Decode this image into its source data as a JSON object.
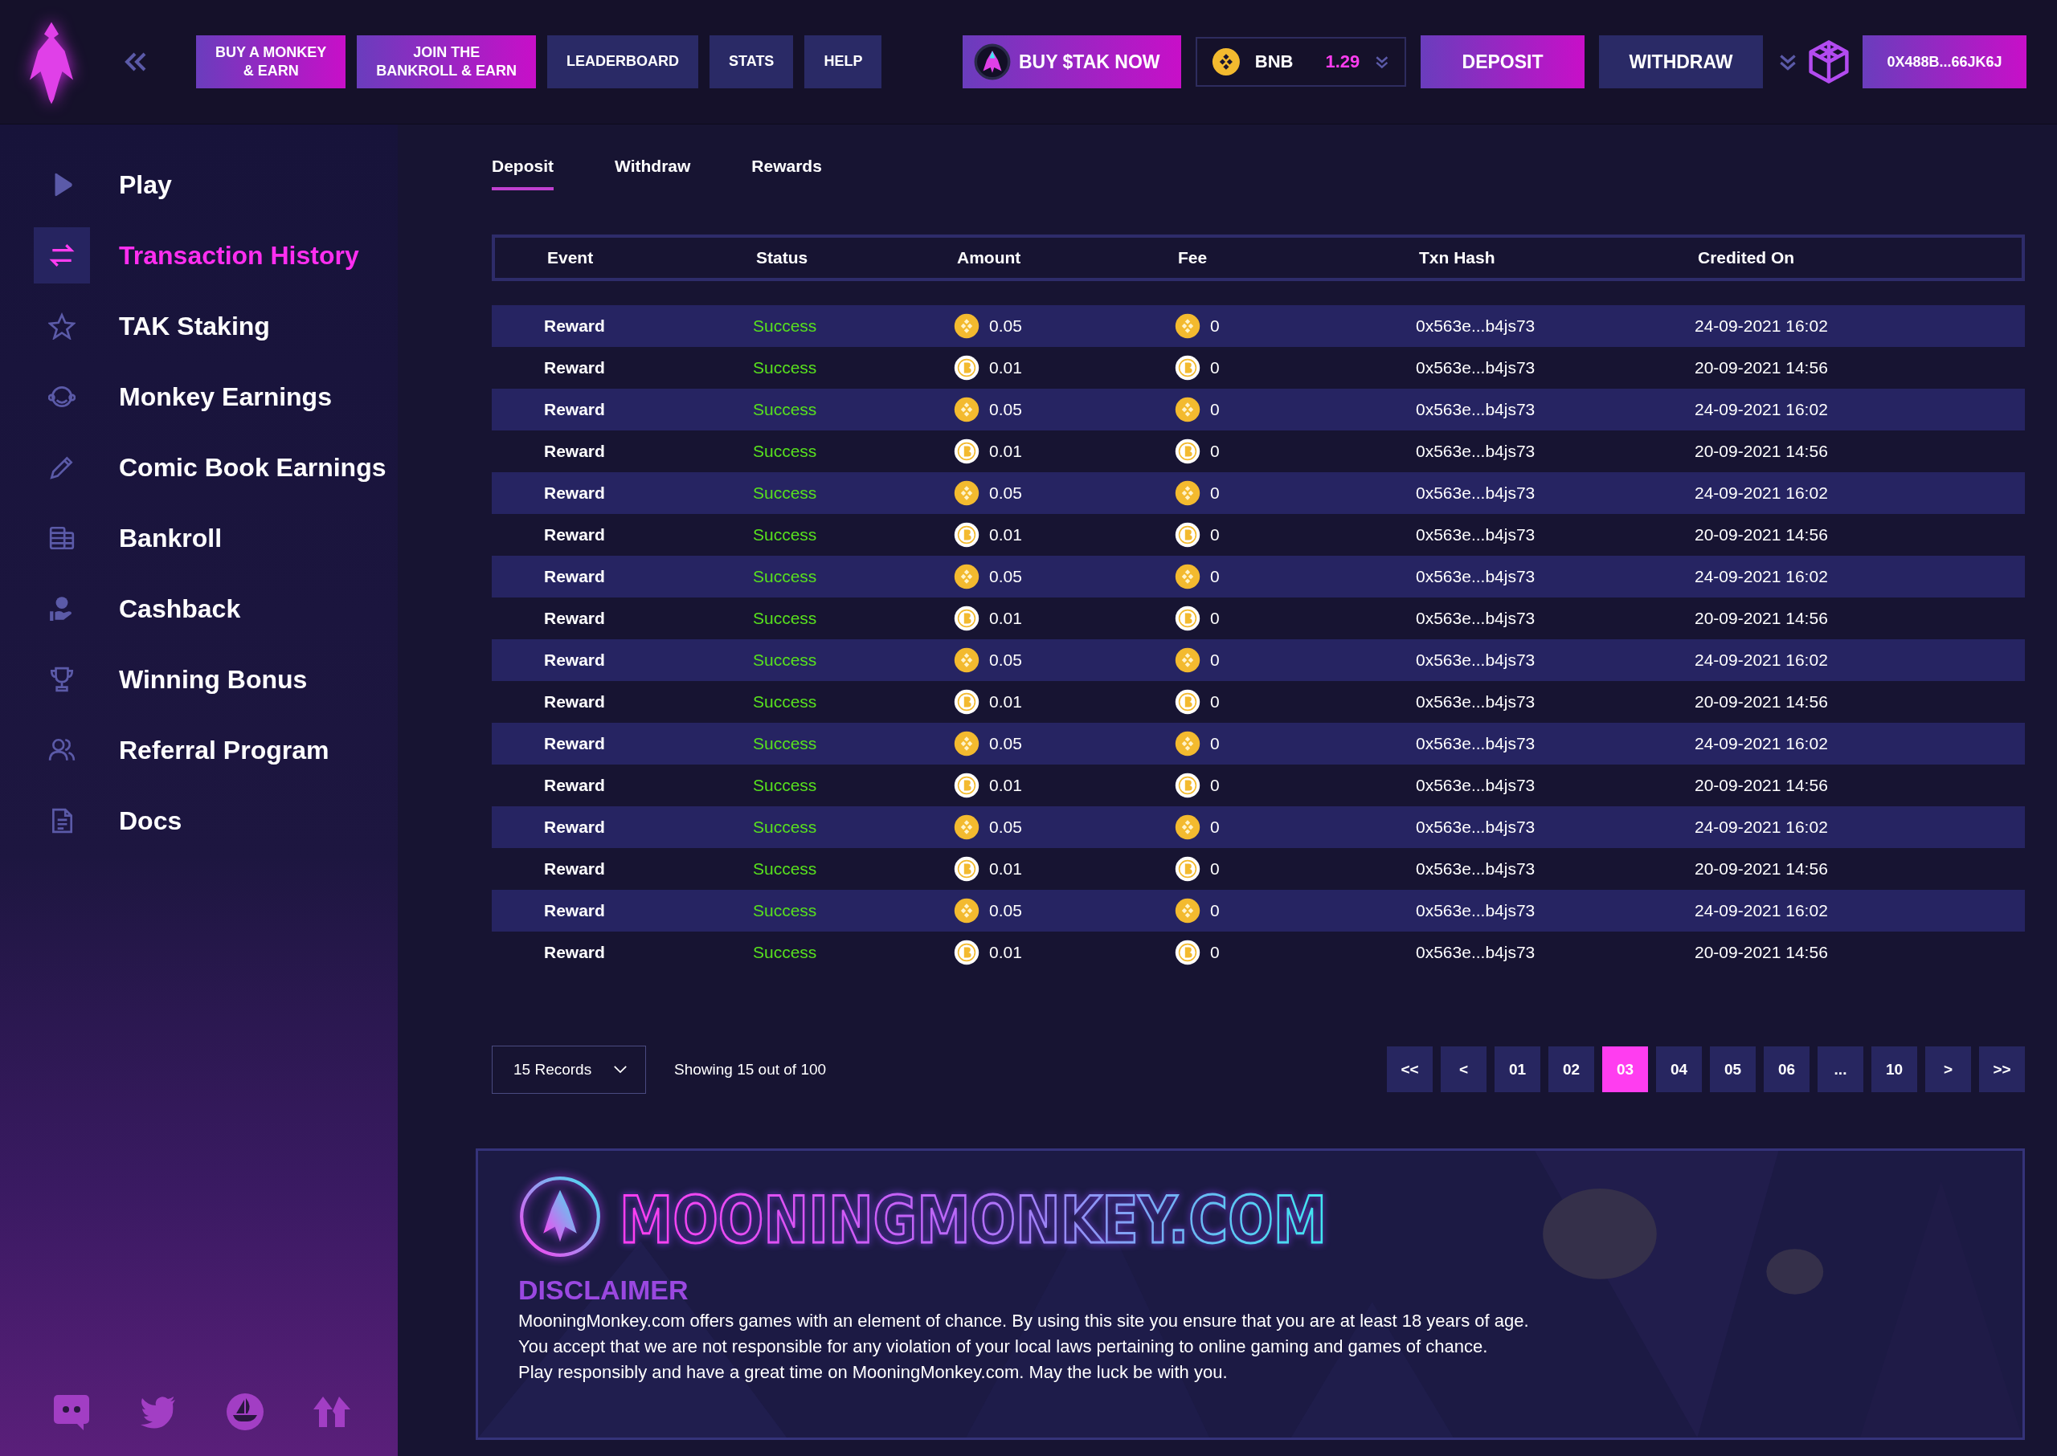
{
  "header": {
    "nav_buttons": [
      {
        "label": "BUY A MONKEY\n& EARN",
        "kind": "gradient"
      },
      {
        "label": "JOIN THE\nBANKROLL & EARN",
        "kind": "gradient"
      },
      {
        "label": "LEADERBOARD",
        "kind": "plain"
      },
      {
        "label": "STATS",
        "kind": "plain"
      },
      {
        "label": "HELP",
        "kind": "plain"
      }
    ],
    "buy_button": "BUY $TAK NOW",
    "wallet": {
      "currency": "BNB",
      "balance": "1.29"
    },
    "deposit_button": "DEPOSIT",
    "withdraw_button": "WITHDRAW",
    "address_button": "0X488B...66JK6J"
  },
  "sidebar": {
    "items": [
      {
        "label": "Play",
        "selected": false
      },
      {
        "label": "Transaction History",
        "selected": true
      },
      {
        "label": "TAK Staking",
        "selected": false
      },
      {
        "label": "Monkey Earnings",
        "selected": false
      },
      {
        "label": "Comic Book Earnings",
        "selected": false
      },
      {
        "label": "Bankroll",
        "selected": false
      },
      {
        "label": "Cashback",
        "selected": false
      },
      {
        "label": "Winning Bonus",
        "selected": false
      },
      {
        "label": "Referral Program",
        "selected": false
      },
      {
        "label": "Docs",
        "selected": false
      }
    ]
  },
  "tabs": [
    {
      "label": "Deposit",
      "selected": true
    },
    {
      "label": "Withdraw",
      "selected": false
    },
    {
      "label": "Rewards",
      "selected": false
    }
  ],
  "table": {
    "columns": [
      "Event",
      "Status",
      "Amount",
      "Fee",
      "Txn Hash",
      "Credited On"
    ],
    "rows": [
      {
        "event": "Reward",
        "status": "Success",
        "kind": "bnb",
        "amount": "0.05",
        "fee": "0",
        "hash": "0x563e...b4js73",
        "date": "24-09-2021 16:02"
      },
      {
        "event": "Reward",
        "status": "Success",
        "kind": "btc",
        "amount": "0.01",
        "fee": "0",
        "hash": "0x563e...b4js73",
        "date": "20-09-2021 14:56"
      },
      {
        "event": "Reward",
        "status": "Success",
        "kind": "bnb",
        "amount": "0.05",
        "fee": "0",
        "hash": "0x563e...b4js73",
        "date": "24-09-2021 16:02"
      },
      {
        "event": "Reward",
        "status": "Success",
        "kind": "btc",
        "amount": "0.01",
        "fee": "0",
        "hash": "0x563e...b4js73",
        "date": "20-09-2021 14:56"
      },
      {
        "event": "Reward",
        "status": "Success",
        "kind": "bnb",
        "amount": "0.05",
        "fee": "0",
        "hash": "0x563e...b4js73",
        "date": "24-09-2021 16:02"
      },
      {
        "event": "Reward",
        "status": "Success",
        "kind": "btc",
        "amount": "0.01",
        "fee": "0",
        "hash": "0x563e...b4js73",
        "date": "20-09-2021 14:56"
      },
      {
        "event": "Reward",
        "status": "Success",
        "kind": "bnb",
        "amount": "0.05",
        "fee": "0",
        "hash": "0x563e...b4js73",
        "date": "24-09-2021 16:02"
      },
      {
        "event": "Reward",
        "status": "Success",
        "kind": "btc",
        "amount": "0.01",
        "fee": "0",
        "hash": "0x563e...b4js73",
        "date": "20-09-2021 14:56"
      },
      {
        "event": "Reward",
        "status": "Success",
        "kind": "bnb",
        "amount": "0.05",
        "fee": "0",
        "hash": "0x563e...b4js73",
        "date": "24-09-2021 16:02"
      },
      {
        "event": "Reward",
        "status": "Success",
        "kind": "btc",
        "amount": "0.01",
        "fee": "0",
        "hash": "0x563e...b4js73",
        "date": "20-09-2021 14:56"
      },
      {
        "event": "Reward",
        "status": "Success",
        "kind": "bnb",
        "amount": "0.05",
        "fee": "0",
        "hash": "0x563e...b4js73",
        "date": "24-09-2021 16:02"
      },
      {
        "event": "Reward",
        "status": "Success",
        "kind": "btc",
        "amount": "0.01",
        "fee": "0",
        "hash": "0x563e...b4js73",
        "date": "20-09-2021 14:56"
      },
      {
        "event": "Reward",
        "status": "Success",
        "kind": "bnb",
        "amount": "0.05",
        "fee": "0",
        "hash": "0x563e...b4js73",
        "date": "24-09-2021 16:02"
      },
      {
        "event": "Reward",
        "status": "Success",
        "kind": "btc",
        "amount": "0.01",
        "fee": "0",
        "hash": "0x563e...b4js73",
        "date": "20-09-2021 14:56"
      },
      {
        "event": "Reward",
        "status": "Success",
        "kind": "bnb",
        "amount": "0.05",
        "fee": "0",
        "hash": "0x563e...b4js73",
        "date": "24-09-2021 16:02"
      },
      {
        "event": "Reward",
        "status": "Success",
        "kind": "btc",
        "amount": "0.01",
        "fee": "0",
        "hash": "0x563e...b4js73",
        "date": "20-09-2021 14:56"
      }
    ]
  },
  "pager": {
    "records": "15 Records",
    "showing": "Showing 15 out of 100",
    "first": "<<",
    "prev": "<",
    "next": ">",
    "last": ">>",
    "pages": [
      {
        "label": "01",
        "selected": false
      },
      {
        "label": "02",
        "selected": false
      },
      {
        "label": "03",
        "selected": true
      },
      {
        "label": "04",
        "selected": false
      },
      {
        "label": "05",
        "selected": false
      },
      {
        "label": "06",
        "selected": false
      },
      {
        "label": "...",
        "selected": false
      },
      {
        "label": "10",
        "selected": false
      }
    ]
  },
  "banner": {
    "brand": "MOONINGMONKEY.COM",
    "heading": "DISCLAIMER",
    "lines": [
      "MooningMonkey.com offers games with an element of chance. By using this site you ensure that you are at least 18 years of age.",
      "You accept that we are not responsible for any violation of your local laws pertaining to online gaming and games of chance.",
      "Play responsibly and have a great time on MooningMonkey.com. May the luck be with you."
    ]
  }
}
